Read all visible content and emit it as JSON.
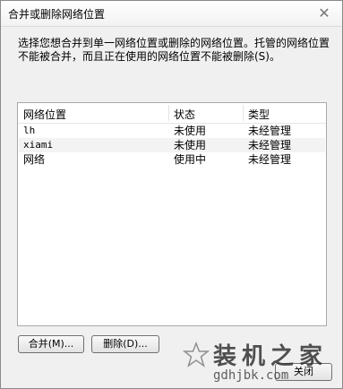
{
  "window": {
    "title": "合并或删除网络位置"
  },
  "description": "选择您想合并到单一网络位置或删除的网络位置。托管的网络位置不能被合并，而且正在使用的网络位置不能被删除(S)。",
  "table": {
    "columns": [
      "网络位置",
      "状态",
      "类型"
    ],
    "rows": [
      {
        "name": "lh",
        "status": "未使用",
        "type": "未经管理"
      },
      {
        "name": "xiami",
        "status": "未使用",
        "type": "未经管理"
      },
      {
        "name": "网络",
        "status": "使用中",
        "type": "未经管理"
      }
    ]
  },
  "buttons": {
    "merge": "合并(M)...",
    "delete": "删除(D)...",
    "close": "关闭"
  },
  "watermark": {
    "brand": "装机之家",
    "url": "gdhjbk.com"
  }
}
